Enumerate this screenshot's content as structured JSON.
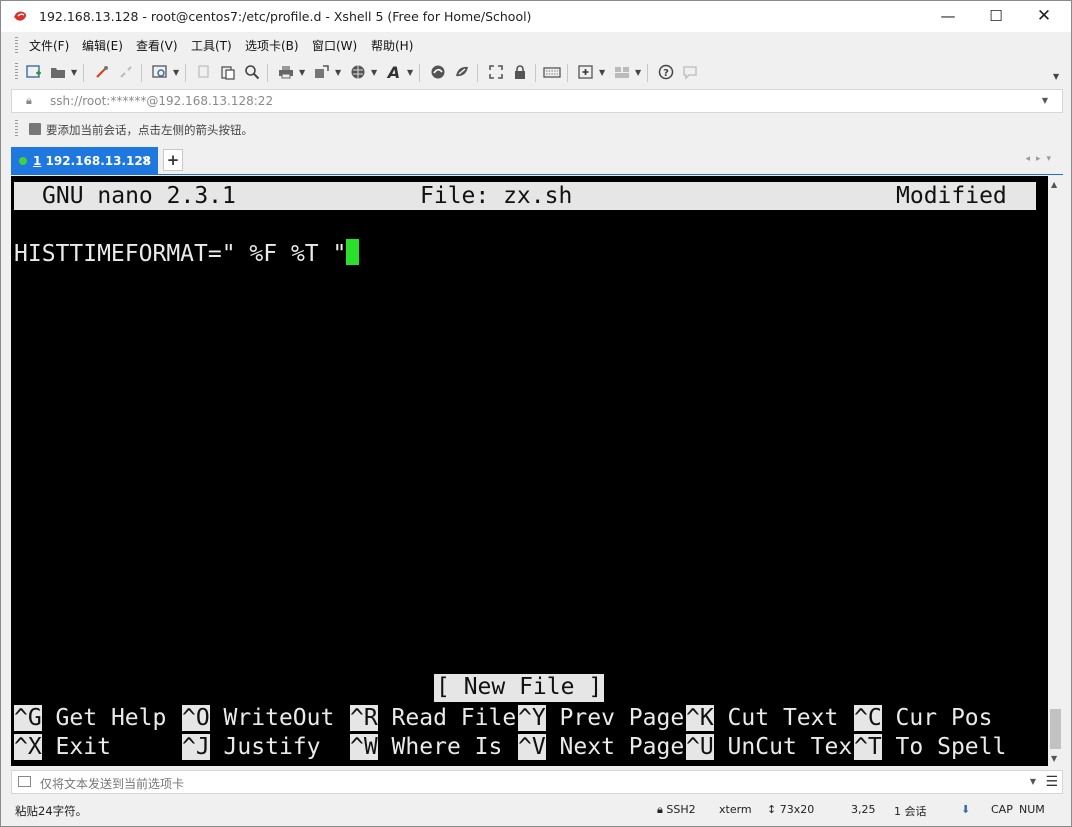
{
  "window": {
    "title": "192.168.13.128 - root@centos7:/etc/profile.d - Xshell 5 (Free for Home/School)",
    "controls": {
      "minimize": "—",
      "maximize": "☐",
      "close": "✕"
    }
  },
  "menu": [
    {
      "label": "文件(F)"
    },
    {
      "label": "编辑(E)"
    },
    {
      "label": "查看(V)"
    },
    {
      "label": "工具(T)"
    },
    {
      "label": "选项卡(B)"
    },
    {
      "label": "窗口(W)"
    },
    {
      "label": "帮助(H)"
    }
  ],
  "toolbar": {
    "icons": [
      "new-session-icon",
      "open-folder-icon",
      "connect-icon",
      "disconnect-icon",
      "properties-icon",
      "copy-icon",
      "paste-icon",
      "find-icon",
      "print-icon",
      "transfer-icon",
      "globe-icon",
      "font-icon",
      "xftp-icon",
      "xagent-icon",
      "fullscreen-icon",
      "lock-icon",
      "keyboard-icon",
      "new-tab-icon",
      "layout-icon",
      "help-icon",
      "chat-icon"
    ]
  },
  "address": {
    "text": "ssh://root:******@192.168.13.128:22"
  },
  "hint": {
    "text": "要添加当前会话，点击左侧的箭头按钮。"
  },
  "tabs": [
    {
      "number": "1",
      "label": "192.168.13.128",
      "close": "×",
      "status_color": "#3fd23f"
    }
  ],
  "tab_add": "+",
  "tab_nav": "◂▸▾",
  "terminal": {
    "header_left": "GNU nano 2.3.1",
    "header_center": "File: zx.sh",
    "header_right": "Modified",
    "content_line": "HISTTIMEFORMAT=\" %F %T \"",
    "status_message": "[ New File ]",
    "shortcuts_row1": [
      {
        "key": "^G",
        "label": " Get Help"
      },
      {
        "key": "^O",
        "label": " WriteOut"
      },
      {
        "key": "^R",
        "label": " Read File"
      },
      {
        "key": "^Y",
        "label": " Prev Page"
      },
      {
        "key": "^K",
        "label": " Cut Text"
      },
      {
        "key": "^C",
        "label": " Cur Pos"
      }
    ],
    "shortcuts_row2": [
      {
        "key": "^X",
        "label": " Exit"
      },
      {
        "key": "^J",
        "label": " Justify"
      },
      {
        "key": "^W",
        "label": " Where Is"
      },
      {
        "key": "^V",
        "label": " Next Page"
      },
      {
        "key": "^U",
        "label": " UnCut Tex"
      },
      {
        "key": "^T",
        "label": " To Spell"
      }
    ],
    "cursor_color": "#2be02b"
  },
  "compose": {
    "placeholder": "仅将文本发送到当前选项卡"
  },
  "status": {
    "left": "粘贴24字符。",
    "protocol": "SSH2",
    "terminal_type": "xterm",
    "size": "73x20",
    "cursor_pos": "3,25",
    "sessions": "1 会话",
    "caps": "CAP",
    "num": "NUM"
  }
}
